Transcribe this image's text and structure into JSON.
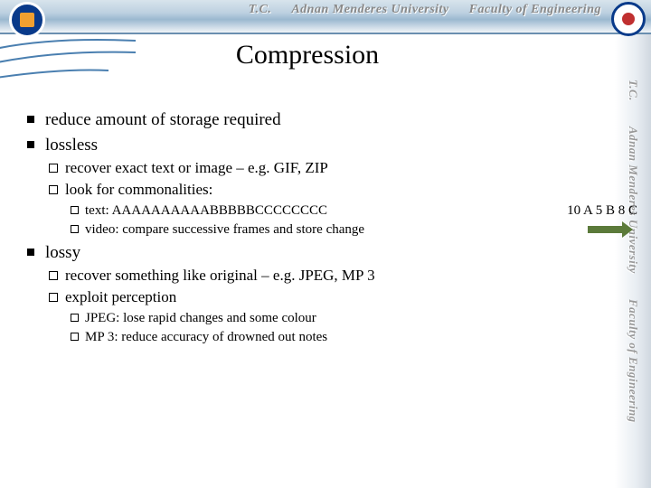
{
  "header": {
    "tc": "T.C.",
    "university": "Adnan Menderes University",
    "faculty": "Faculty of Engineering"
  },
  "side": {
    "tc": "T.C.",
    "university": "Adnan Menderes University",
    "faculty": "Faculty of Engineering"
  },
  "slide": {
    "title": "Compression",
    "bullets": {
      "b1": "reduce amount of storage required",
      "b2": "lossless",
      "b2a": "recover exact text or image – e.g. GIF, ZIP",
      "b2b": "look for commonalities:",
      "b2b1": "text: AAAAAAAAAABBBBBCCCCCCCC",
      "b2b1_enc": "10 A 5 B 8 C",
      "b2b2": "video:  compare successive frames and store change",
      "b3": "lossy",
      "b3a": "recover something like original – e.g. JPEG, MP 3",
      "b3b": "exploit perception",
      "b3b1": "JPEG: lose rapid changes and some colour",
      "b3b2": "MP 3: reduce accuracy of drowned out notes"
    }
  }
}
